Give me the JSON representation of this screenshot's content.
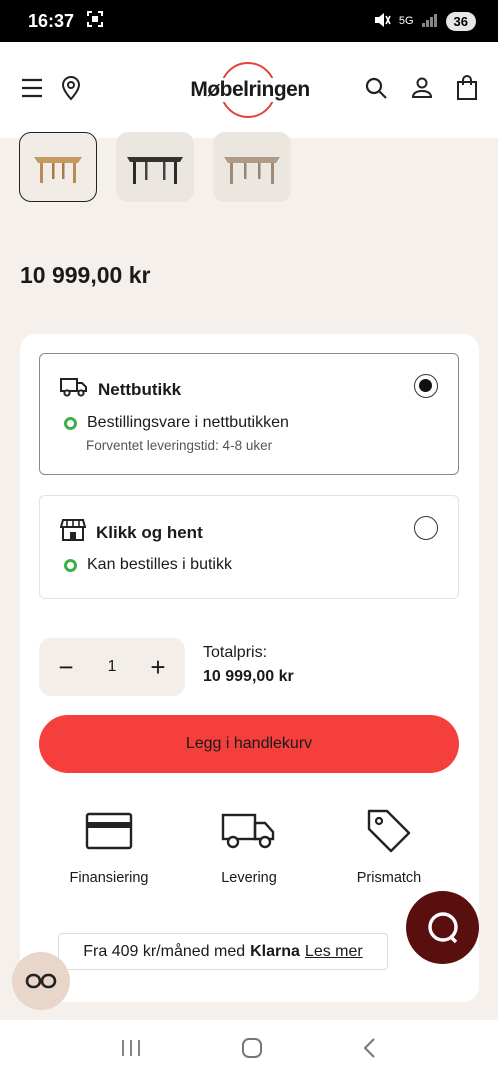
{
  "status_bar": {
    "time": "16:37",
    "network": "5G",
    "battery": "36"
  },
  "header": {
    "logo_text": "Møbelringen",
    "icons": [
      "menu-icon",
      "location-pin-icon",
      "search-icon",
      "user-icon",
      "shopping-bag-icon"
    ]
  },
  "product": {
    "price": "10 999,00 kr"
  },
  "delivery": {
    "options": [
      {
        "title": "Nettbutikk",
        "status": "Bestillingsvare i nettbutikken",
        "sub": "Forventet leveringstid: 4-8 uker",
        "selected": true,
        "icon": "truck-icon"
      },
      {
        "title": "Klikk og hent",
        "status": "Kan bestilles i butikk",
        "selected": false,
        "icon": "store-icon"
      }
    ]
  },
  "quantity": {
    "value": "1",
    "minus": "−",
    "plus": "+"
  },
  "total": {
    "label": "Totalpris:",
    "value": "10 999,00 kr"
  },
  "cart_button": {
    "label": "Legg i handlekurv"
  },
  "features": [
    {
      "label": "Finansiering",
      "icon": "credit-card-icon"
    },
    {
      "label": "Levering",
      "icon": "delivery-truck-icon"
    },
    {
      "label": "Prismatch",
      "icon": "price-tag-icon"
    }
  ],
  "klarna": {
    "text": "Fra 409 kr/måned med",
    "brand": "Klarna",
    "link": "Les mer"
  },
  "colors": {
    "accent_red": "#f43f3c",
    "chat_bg": "#5a0f0f",
    "status_green": "#3fae4a",
    "page_bg": "#f5f0ec"
  }
}
